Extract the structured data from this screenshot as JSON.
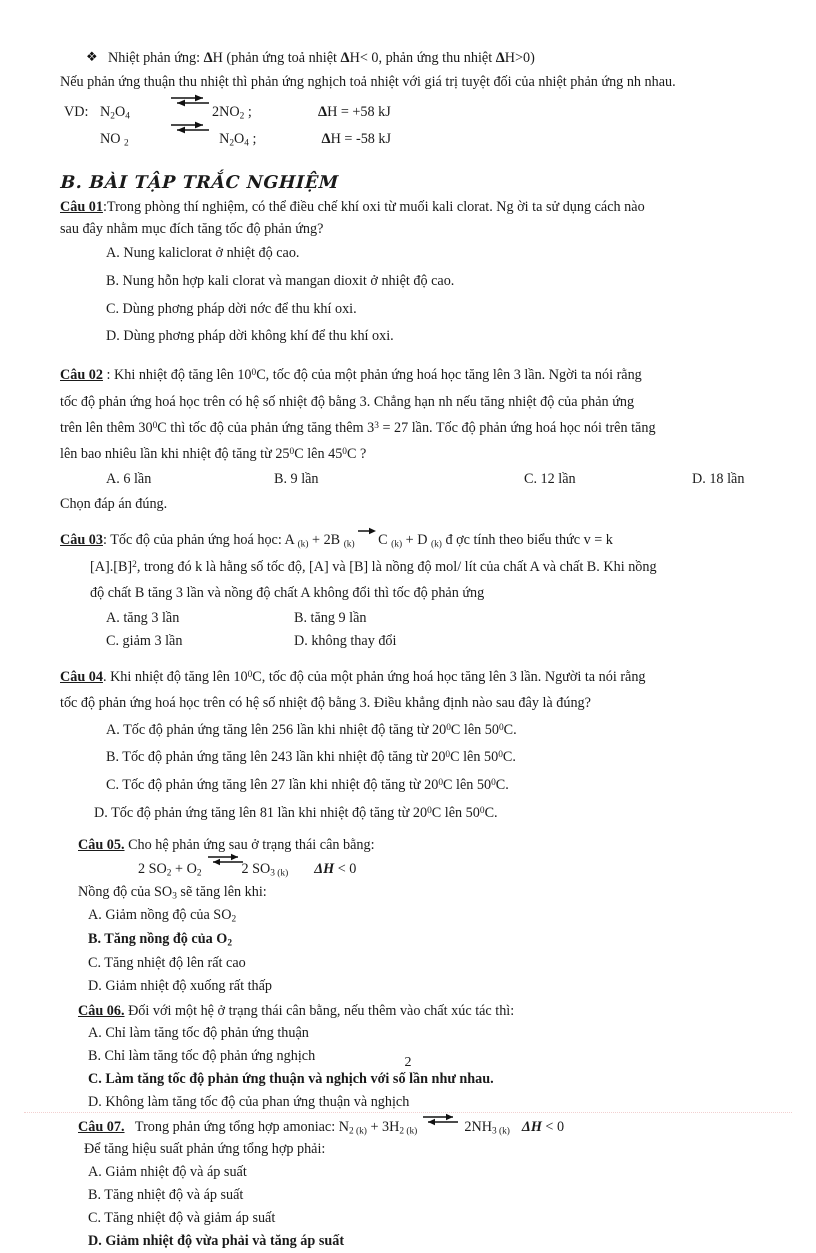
{
  "document": {
    "page_number": "2",
    "language": "vi"
  },
  "intro": {
    "bullet_glyph": "❖",
    "bullet_line_pre": "Nhiệt phản ứng: ",
    "bullet_delta_1": "Δ",
    "bullet_line_mid1": "H (phản ứng toả nhiệt ",
    "bullet_delta_2": "Δ",
    "bullet_line_mid2": "H< 0, phản ứng thu nhiệt ",
    "bullet_delta_3": "Δ",
    "bullet_line_end": "H>0)",
    "paragraph": "Nếu phản ứng thuận thu nhiệt thì phản ứng nghịch toả nhiệt với giá trị tuyệt đối của nhiệt phản ứng nh  nhau."
  },
  "example": {
    "label": "VD:",
    "rows": [
      {
        "left_formula": "N2O4",
        "left_parts": [
          {
            "t": "N",
            "s": ""
          },
          {
            "t": "2",
            "s": "sub"
          },
          {
            "t": "O",
            "s": ""
          },
          {
            "t": "4",
            "s": "sub"
          }
        ],
        "right_parts": [
          {
            "t": "2NO",
            "s": ""
          },
          {
            "t": "2",
            "s": "sub"
          },
          {
            "t": " ;",
            "s": ""
          }
        ],
        "delta": "Δ",
        "enthalpy": "H = +58 kJ"
      },
      {
        "left_formula": "NO 2",
        "left_parts": [
          {
            "t": "NO ",
            "s": ""
          },
          {
            "t": "2",
            "s": "sub"
          }
        ],
        "right_parts": [
          {
            "t": "N",
            "s": ""
          },
          {
            "t": "2",
            "s": "sub"
          },
          {
            "t": "O",
            "s": ""
          },
          {
            "t": "4",
            "s": "sub"
          },
          {
            "t": " ;",
            "s": ""
          }
        ],
        "delta": "Δ",
        "enthalpy": "H = -58 kJ"
      }
    ]
  },
  "section": {
    "heading": "B. BÀI TẬP TRẮC NGHIỆM"
  },
  "questions": {
    "q01": {
      "label": "Câu 01",
      "stem_a": ":Trong  phòng thí nghiệm, có thể điều chế khí oxi từ muối kali clorat. Ng ời   ta sử dụng cách nào",
      "stem_b": "sau đây nhằm mục đích tăng tốc độ phản ứng?",
      "options": [
        "A. Nung kaliclorat ở nhiệt độ cao.",
        "B. Nung hỗn hợp kali clorat và mangan dioxit ở nhiệt độ cao.",
        "C. Dùng phơng   pháp dời nớc  để thu khí oxi.",
        "D. Dùng phơng   pháp dời không khí để thu khí oxi."
      ]
    },
    "q02": {
      "label": "Câu 02",
      "line1_a": " : Khi nhiệt độ tăng lên 10",
      "line1_sup": "0",
      "line1_b": "C, tốc độ của một phản ứng hoá học tăng lên 3 lần. Ngời   ta nói rằng",
      "line2": "tốc độ phản ứng hoá học trên có hệ số nhiệt độ bằng 3.  Chẳng hạn nh   nếu tăng nhiệt độ của phản ứng",
      "line3_a": "trên lên thêm 30",
      "line3_sup": "0",
      "line3_b": "C thì tốc độ của phản ứng tăng thêm 3",
      "line3_sup2": "3",
      "line3_c": " = 27 lần. Tốc độ phản ứng hoá học nói trên tăng",
      "line4_a": "lên bao nhiêu lần khi nhiệt độ tăng từ 25",
      "line4_sup": "0",
      "line4_b": "C lên 45",
      "line4_sup2": "0",
      "line4_c": "C ?",
      "options": [
        "A. 6 lần",
        "B. 9 lần",
        "C. 12 lần",
        "D. 18 lần"
      ],
      "note": "Chọn đáp án đúng."
    },
    "q03": {
      "label": "Câu 03",
      "line1_a": ": Tốc độ của phản ứng hoá học: A ",
      "line1_k1": "(k)",
      "line1_b": " + 2B ",
      "line1_k2": "(k)",
      "line1_c": " C ",
      "line1_k3": "(k)",
      "line1_d": " + D ",
      "line1_k4": "(k)",
      "line1_e": "  đ   ợc  tính theo biểu thức ",
      "line1_v": "v",
      "line1_f": " = k",
      "line2_a": "[A].[B]",
      "line2_sup": "2",
      "line2_b": ", trong đó k là hằng số tốc độ, [A] và [B] là nồng độ mol/ lít của chất A và chất B. Khi nồng",
      "line3": "độ chất B tăng 3 lần và nồng độ chất A không đổi thì tốc độ phản ứng",
      "options": [
        "A.   tăng 3 lần",
        "B.    tăng 9 lần",
        "C.   giảm 3 lần",
        "D.    không thay đổi"
      ]
    },
    "q04": {
      "label": "Câu 04",
      "line1_a": ". Khi nhiệt  độ tăng lên 10",
      "line1_sup": "0",
      "line1_b": "C, tốc độ của một phản ứng hoá học tăng lên 3 lần.  Người ta nói rằng",
      "line2": "tốc độ phản ứng hoá học trên có hệ số nhiệt  độ bằng 3. Điều khẳng định nào sau đây là đúng?",
      "options": [
        {
          "pre": "A. Tốc độ phản ứng tăng lên 256 lần khi nhiệt  độ tăng từ 20",
          "sup1": "0",
          "mid": "C lên 50",
          "sup2": "0",
          "post": "C."
        },
        {
          "pre": "B. Tốc độ phản ứng tăng lên 243 lần khi nhiệt  độ tăng từ 20",
          "sup1": "0",
          "mid": "C lên 50",
          "sup2": "0",
          "post": "C."
        },
        {
          "pre": "C. Tốc độ phản ứng tăng lên 27 lần khi nhiệt  độ tăng từ 20",
          "sup1": "0",
          "mid": "C lên 50",
          "sup2": "0",
          "post": "C."
        },
        {
          "pre": "D. Tốc độ phản ứng tăng lên 81 lần khi nhiệt  độ tăng từ 20",
          "sup1": "0",
          "mid": "C lên 50",
          "sup2": "0",
          "post": "C."
        }
      ]
    },
    "q05": {
      "label": "Câu 05.",
      "stem": "  Cho hệ phản ứng sau ở trạng thái cân bằng:",
      "eq_left_parts": [
        {
          "t": "2 SO",
          "s": ""
        },
        {
          "t": "2",
          "s": "sub"
        },
        {
          "t": " + O",
          "s": ""
        },
        {
          "t": "2",
          "s": "sub"
        }
      ],
      "eq_right_parts": [
        {
          "t": "2 SO",
          "s": ""
        },
        {
          "t": "3 (k)",
          "s": "sub"
        }
      ],
      "eq_delta": "ΔH",
      "eq_tail": " < 0",
      "subline_a": "Nồng độ của SO",
      "subline_sub": "3",
      "subline_b": " sẽ tăng lên khi:",
      "options": [
        {
          "parts": [
            {
              "t": "A.  Giảm nồng độ của SO",
              "s": ""
            },
            {
              "t": "2",
              "s": "sub"
            }
          ],
          "bold": false
        },
        {
          "parts": [
            {
              "t": "B.  Tăng nồng độ của O",
              "s": ""
            },
            {
              "t": "2",
              "s": "sub"
            }
          ],
          "bold": true
        },
        {
          "parts": [
            {
              "t": "C.  Tăng nhiệt độ lên rất cao",
              "s": ""
            }
          ],
          "bold": false
        },
        {
          "parts": [
            {
              "t": "D.  Giảm nhiệt độ xuống rất thấp",
              "s": ""
            }
          ],
          "bold": false
        }
      ]
    },
    "q06": {
      "label": "Câu 06.",
      "stem": "   Đối với một hệ ở trạng thái cân bằng, nếu thêm vào chất xúc tác thì:",
      "options": [
        {
          "text": "A. Chỉ làm tăng tốc độ phản ứng thuận",
          "bold": false
        },
        {
          "text": "B. Chỉ làm tăng tốc độ phản ứng  nghịch",
          "bold": false
        },
        {
          "text": "C. Làm tăng tốc độ phản ứng thuận  và nghịch với số lần như nhau.",
          "bold": true
        },
        {
          "text": "D. Không làm tăng tốc độ của phan ứng thuận  và nghịch",
          "bold": false
        }
      ]
    },
    "q07": {
      "label": "Câu 07.",
      "stem": "   Trong phản ứng tổng hợp amoniac: ",
      "eq_left_parts": [
        {
          "t": "N",
          "s": ""
        },
        {
          "t": "2 (k)",
          "s": "sub"
        },
        {
          "t": " + 3H",
          "s": ""
        },
        {
          "t": "2 (k)",
          "s": "sub"
        }
      ],
      "eq_right_parts": [
        {
          "t": "2NH",
          "s": ""
        },
        {
          "t": "3 (k)",
          "s": "sub"
        }
      ],
      "eq_delta": "ΔH",
      "eq_tail": " < 0",
      "subline": "Để tăng hiệu suất phản ứng tổng hợp phải:",
      "options": [
        {
          "text": "A.  Giảm nhiệt độ và áp suất",
          "bold": false
        },
        {
          "text": "B.  Tăng nhiệt độ và áp suất",
          "bold": false
        },
        {
          "text": "C.  Tăng nhiệt độ và giảm  áp suất",
          "bold": false
        },
        {
          "text": "D.  Giảm nhiệt độ vừa phải và tăng áp suất",
          "bold": true
        }
      ]
    }
  }
}
